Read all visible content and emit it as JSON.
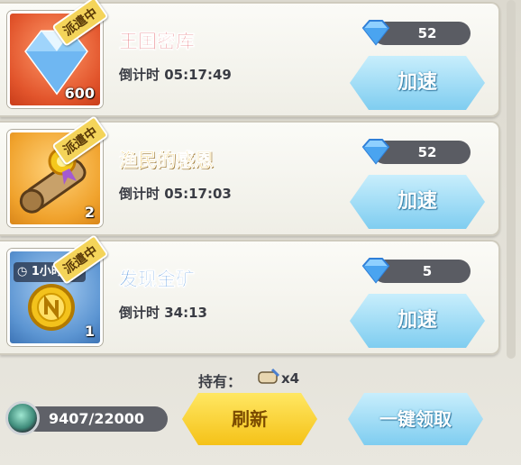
{
  "missions": [
    {
      "status_badge": "派遣中",
      "title": "王国密库",
      "timer": "倒计时 05:17:49",
      "reward_count": "600",
      "reward_icon": "diamond-icon",
      "cost": "52",
      "speed_label": "加速",
      "theme": "red",
      "title_color": "#d62a32"
    },
    {
      "status_badge": "派遣中",
      "title": "渔民的感恩",
      "timer": "倒计时 05:17:03",
      "reward_count": "2",
      "reward_icon": "scroll-icon",
      "cost": "52",
      "speed_label": "加速",
      "theme": "orange",
      "title_color": "#e6a800"
    },
    {
      "status_badge": "派遣中",
      "title": "发现金矿",
      "timer": "倒计时 34:13",
      "reward_count": "1",
      "reward_icon": "gold-coin-icon",
      "reward_duration": "1小时",
      "cost": "5",
      "speed_label": "加速",
      "theme": "blue",
      "title_color": "#2f7ed6"
    }
  ],
  "footer": {
    "hold_label": "持有：",
    "hold_count": "x4",
    "hold_icon": "scroll-icon",
    "energy": "9407/22000",
    "energy_icon": "energy-orb-icon",
    "refresh_label": "刷新",
    "claim_all_label": "一键领取"
  },
  "colors": {
    "speed_button": "#7fcdf0",
    "refresh_button": "#f5c218",
    "pill": "#5a5c63"
  }
}
